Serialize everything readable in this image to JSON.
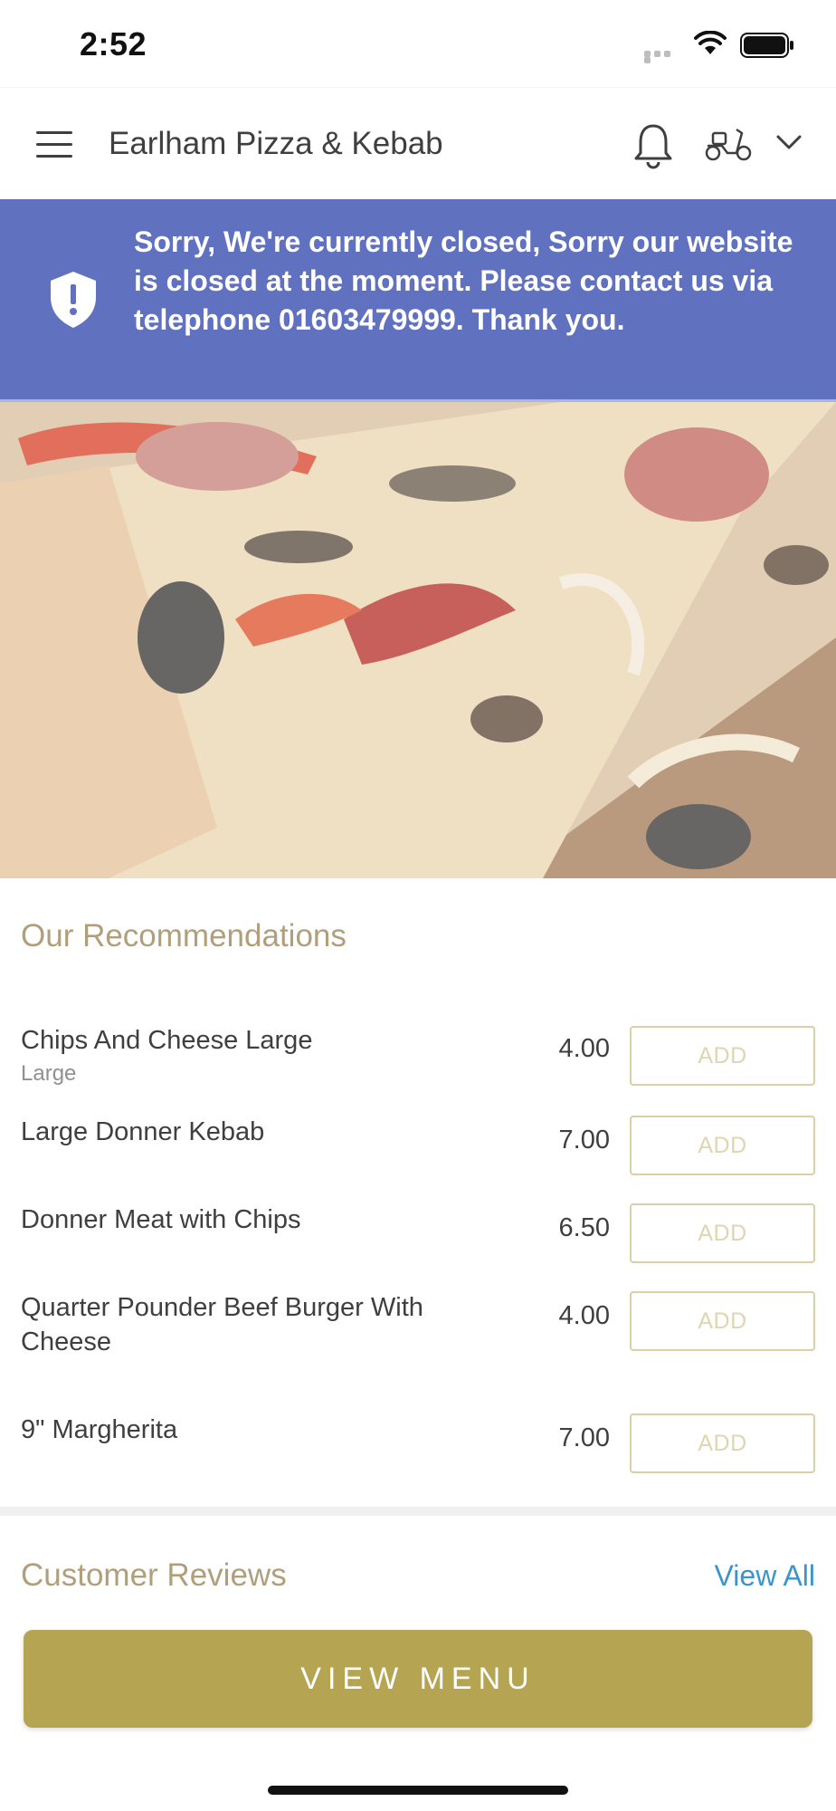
{
  "status_bar": {
    "time": "2:52"
  },
  "header": {
    "title": "Earlham Pizza & Kebab"
  },
  "banner": {
    "message": "Sorry, We're currently closed, Sorry our website is closed at the moment. Please contact us via telephone 01603479999. Thank you."
  },
  "recommendations": {
    "title": "Our Recommendations",
    "items": [
      {
        "name": "Chips And Cheese Large",
        "sub": "Large",
        "price": "4.00",
        "add_label": "ADD"
      },
      {
        "name": "Large Donner Kebab",
        "sub": "",
        "price": "7.00",
        "add_label": "ADD"
      },
      {
        "name": "Donner Meat with Chips",
        "sub": "",
        "price": "6.50",
        "add_label": "ADD"
      },
      {
        "name": "Quarter Pounder Beef Burger With Cheese",
        "sub": "",
        "price": "4.00",
        "add_label": "ADD"
      },
      {
        "name": "9\" Margherita",
        "sub": "",
        "price": "7.00",
        "add_label": "ADD"
      }
    ]
  },
  "reviews": {
    "title": "Customer Reviews",
    "view_all_label": "View All"
  },
  "footer": {
    "view_menu_label": "VIEW MENU"
  },
  "colors": {
    "banner_bg": "#5769bc",
    "accent_gold": "#b5a451",
    "section_title": "#ad9a74",
    "link_blue": "#2f8fc9"
  },
  "icons": [
    "hamburger-icon",
    "bell-icon",
    "scooter-icon",
    "chevron-down-icon",
    "shield-alert-icon",
    "wifi-icon",
    "battery-icon"
  ]
}
